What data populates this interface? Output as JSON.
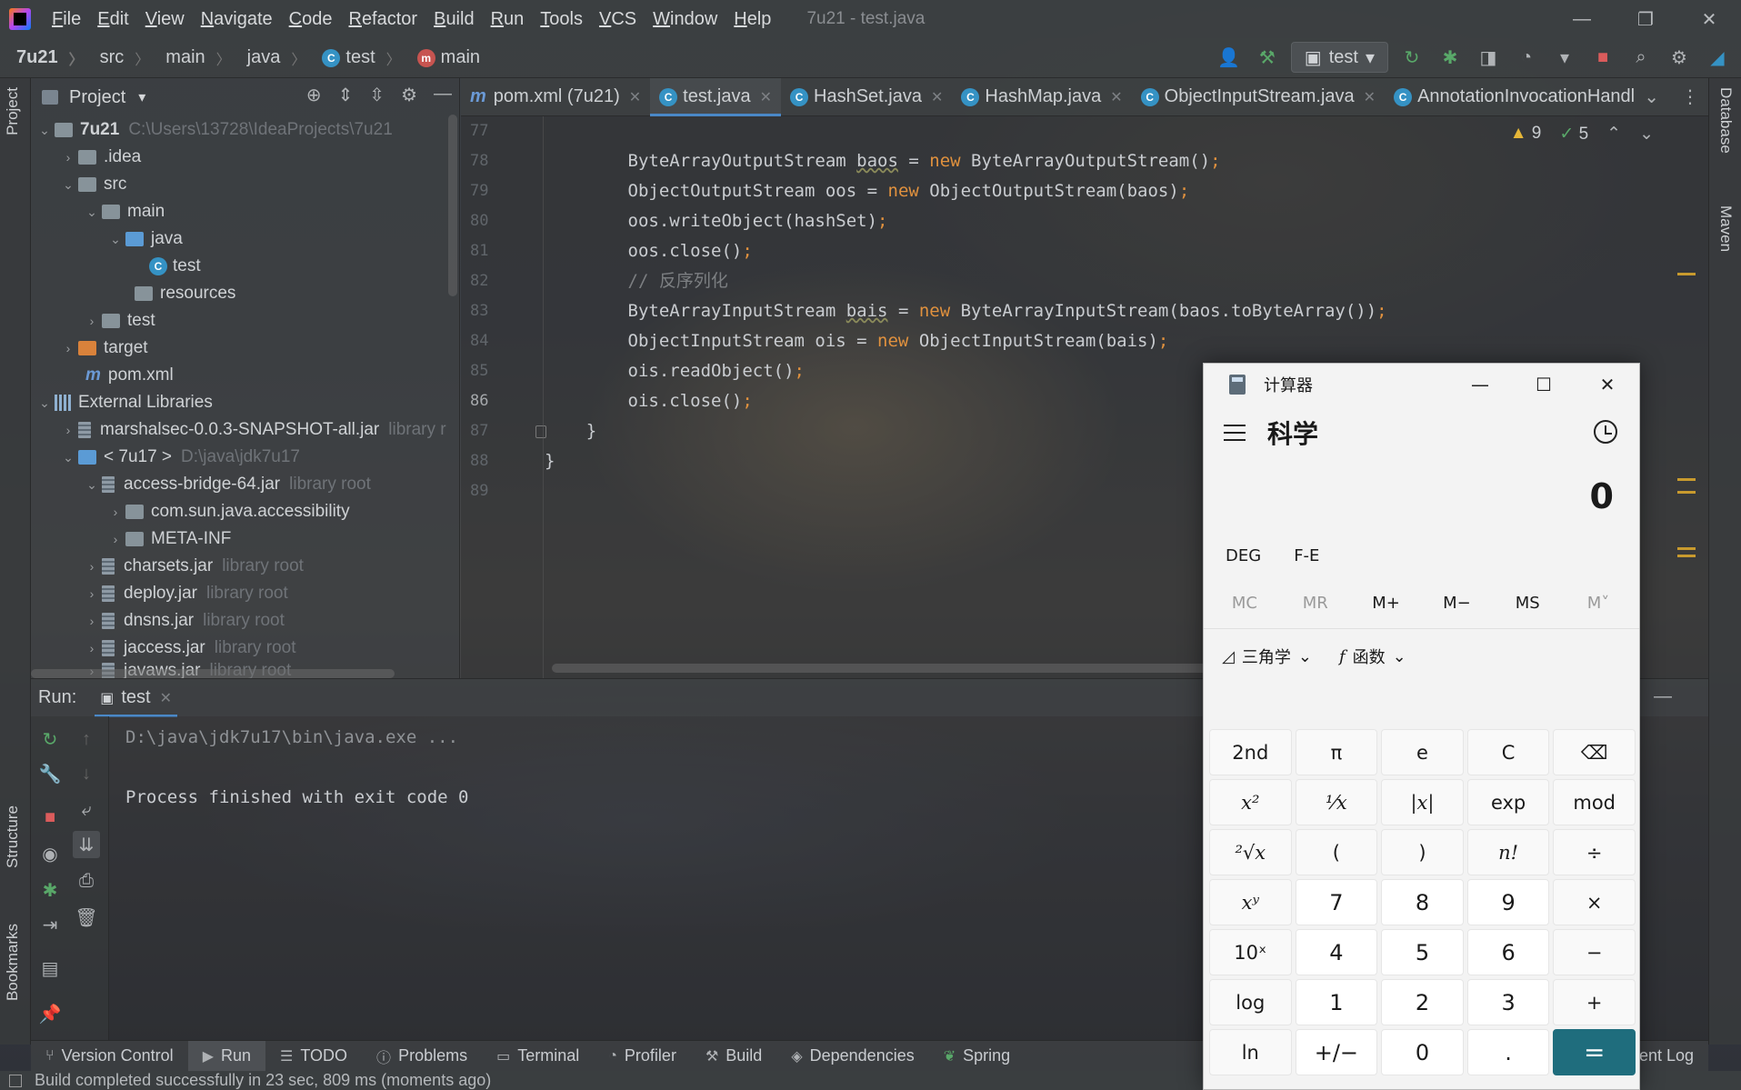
{
  "menubar": {
    "items": [
      "File",
      "Edit",
      "View",
      "Navigate",
      "Code",
      "Refactor",
      "Build",
      "Run",
      "Tools",
      "VCS",
      "Window",
      "Help"
    ],
    "window_title": "7u21 - test.java"
  },
  "navbar": {
    "crumbs": [
      "7u21",
      "src",
      "main",
      "java",
      "test",
      "main"
    ],
    "run_config": "test"
  },
  "left_stripe": {
    "project_tab": "Project",
    "structure_tab": "Structure",
    "bookmarks_tab": "Bookmarks"
  },
  "right_stripe": {
    "database_tab": "Database",
    "maven_tab": "Maven"
  },
  "project": {
    "header": "Project",
    "tree": [
      {
        "label": "7u21",
        "extra": "C:\\Users\\13728\\IdeaProjects\\7u21"
      },
      {
        "label": ".idea"
      },
      {
        "label": "src"
      },
      {
        "label": "main"
      },
      {
        "label": "java"
      },
      {
        "label": "test"
      },
      {
        "label": "resources"
      },
      {
        "label": "test"
      },
      {
        "label": "target"
      },
      {
        "label": "pom.xml"
      },
      {
        "label": "External Libraries"
      },
      {
        "label": "marshalsec-0.0.3-SNAPSHOT-all.jar",
        "extra": "library r"
      },
      {
        "label": "< 7u17 >",
        "extra": "D:\\java\\jdk7u17"
      },
      {
        "label": "access-bridge-64.jar",
        "extra": "library root"
      },
      {
        "label": "com.sun.java.accessibility"
      },
      {
        "label": "META-INF"
      },
      {
        "label": "charsets.jar",
        "extra": "library root"
      },
      {
        "label": "deploy.jar",
        "extra": "library root"
      },
      {
        "label": "dnsns.jar",
        "extra": "library root"
      },
      {
        "label": "jaccess.jar",
        "extra": "library root"
      },
      {
        "label": "javaws.jar",
        "extra": "library root"
      }
    ]
  },
  "editor": {
    "tabs": [
      {
        "label": "pom.xml (7u21)",
        "type": "maven"
      },
      {
        "label": "test.java",
        "type": "class",
        "active": true
      },
      {
        "label": "HashSet.java",
        "type": "class"
      },
      {
        "label": "HashMap.java",
        "type": "class"
      },
      {
        "label": "ObjectInputStream.java",
        "type": "class"
      },
      {
        "label": "AnnotationInvocationHandl",
        "type": "class"
      }
    ],
    "inspections": {
      "warnings": "9",
      "ok": "5"
    },
    "line_numbers": [
      "77",
      "78",
      "79",
      "80",
      "81",
      "82",
      "83",
      "84",
      "85",
      "86",
      "87",
      "88",
      "89"
    ],
    "current_line": "86"
  },
  "run": {
    "label": "Run:",
    "tab": "test",
    "console": [
      "D:\\java\\jdk7u17\\bin\\java.exe ...",
      "Process finished with exit code 0"
    ]
  },
  "bottom_bar": {
    "items": [
      "Version Control",
      "Run",
      "TODO",
      "Problems",
      "Terminal",
      "Profiler",
      "Build",
      "Dependencies",
      "Spring"
    ],
    "event_log": "Event Log"
  },
  "status": {
    "message": "Build completed successfully in 23 sec, 809 ms (moments ago)"
  },
  "calculator": {
    "title": "计算器",
    "mode": "科学",
    "display": "0",
    "angle_mode": "DEG",
    "fe_label": "F-E",
    "memory": [
      "MC",
      "MR",
      "M+",
      "M−",
      "MS",
      "M˅"
    ],
    "trig_label": "三角学",
    "func_label": "函数",
    "keys": [
      "2nd",
      "π",
      "e",
      "C",
      "⌫",
      "x²",
      "¹⁄x",
      "|x|",
      "exp",
      "mod",
      "²√x",
      "(",
      ")",
      "n!",
      "÷",
      "xʸ",
      "7",
      "8",
      "9",
      "×",
      "10ˣ",
      "4",
      "5",
      "6",
      "−",
      "log",
      "1",
      "2",
      "3",
      "+",
      "ln",
      "+/−",
      "0",
      ".",
      "="
    ]
  },
  "colors": {
    "accent": "#4a88c7",
    "keyword": "#e0913e",
    "equals_button": "#1f6d7d"
  }
}
